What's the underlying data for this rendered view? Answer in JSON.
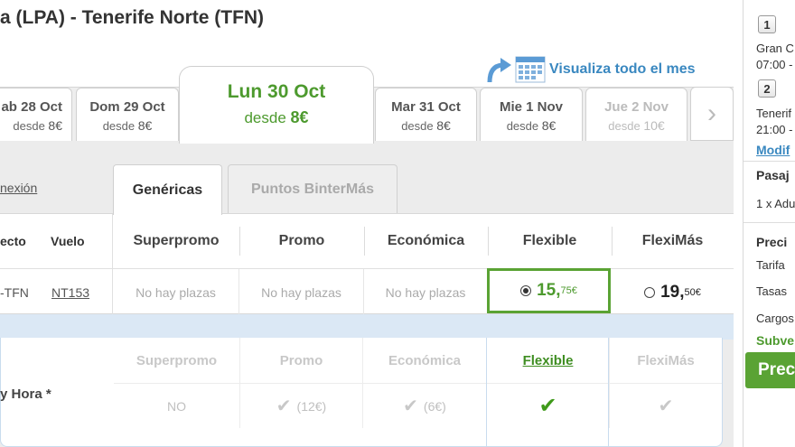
{
  "header": {
    "route_title": "a (LPA) - Tenerife Norte (TFN)",
    "view_month_link": "Visualiza todo el mes"
  },
  "dates": [
    {
      "name": "ab 28 Oct",
      "from": "desde",
      "price": "8€",
      "disabled": false
    },
    {
      "name": "Dom 29 Oct",
      "from": "desde",
      "price": "8€",
      "disabled": false
    },
    {
      "name": "Lun 30 Oct",
      "from": "desde",
      "price": "8€",
      "disabled": false,
      "selected": true
    },
    {
      "name": "Mar 31 Oct",
      "from": "desde",
      "price": "8€",
      "disabled": false
    },
    {
      "name": "Mie 1 Nov",
      "from": "desde",
      "price": "8€",
      "disabled": false
    },
    {
      "name": "Jue 2 Nov",
      "from": "desde",
      "price": "10€",
      "disabled": true
    }
  ],
  "left_panel": {
    "conexion_link": "nexión"
  },
  "tabs": [
    {
      "label": "Genéricas",
      "active": true
    },
    {
      "label": "Puntos BinterMás",
      "active": false
    }
  ],
  "fare_table": {
    "col_route": "ecto",
    "col_flight": "Vuelo",
    "fare_types": [
      "Superpromo",
      "Promo",
      "Económica",
      "Flexible",
      "FlexiMás"
    ],
    "row": {
      "route": "-TFN",
      "flight": "NT153",
      "superpromo": "No hay plazas",
      "promo": "No hay plazas",
      "economica": "No hay plazas",
      "flexible_int": "15,",
      "flexible_dec": "75€",
      "fleximas_int": "19,",
      "fleximas_dec": "50€"
    }
  },
  "details": {
    "headers": [
      "Superpromo",
      "Promo",
      "Económica",
      "Flexible",
      "FlexiMás"
    ],
    "row_label": "y Hora *",
    "row": {
      "superpromo": "NO",
      "promo": "(12€)",
      "economica": "(6€)"
    }
  },
  "sidebar": {
    "step1": "1",
    "step1_line1": "Gran C",
    "step1_line2": "07:00 -",
    "step2": "2",
    "step2_line1": "Tenerif",
    "step2_line2": "21:00 -",
    "modify_link": "Modif",
    "passengers_title": "Pasaj",
    "passengers_value": "1 x Adu",
    "price_title": "Preci",
    "tarifa": "Tarifa",
    "tasas": "Tasas",
    "cargos": "Cargos",
    "subvencion": "Subve",
    "button": "Prec"
  },
  "colors": {
    "accent_green": "#4d9a2e",
    "link_blue": "#3a88c0",
    "band_blue": "#dbe8f5"
  }
}
